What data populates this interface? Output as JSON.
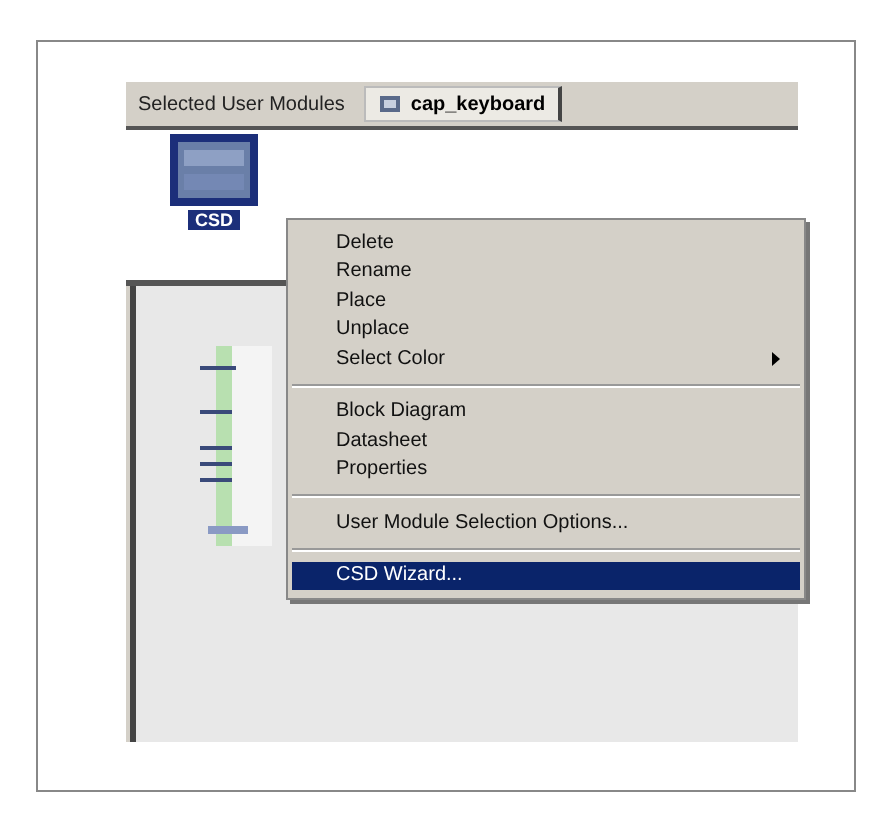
{
  "tab_bar": {
    "label": "Selected User Modules",
    "tabs": [
      {
        "label": "cap_keyboard",
        "selected": true
      }
    ]
  },
  "modules": [
    {
      "label": "CSD",
      "selected": true
    }
  ],
  "context_menu": {
    "items": [
      {
        "kind": "item",
        "label": "Delete",
        "submenu": false,
        "selected": false
      },
      {
        "kind": "item",
        "label": "Rename",
        "submenu": false,
        "selected": false
      },
      {
        "kind": "item",
        "label": "Place",
        "submenu": false,
        "selected": false
      },
      {
        "kind": "item",
        "label": "Unplace",
        "submenu": false,
        "selected": false
      },
      {
        "kind": "item",
        "label": "Select Color",
        "submenu": true,
        "selected": false
      },
      {
        "kind": "separator"
      },
      {
        "kind": "item",
        "label": "Block Diagram",
        "submenu": false,
        "selected": false
      },
      {
        "kind": "item",
        "label": "Datasheet",
        "submenu": false,
        "selected": false
      },
      {
        "kind": "item",
        "label": "Properties",
        "submenu": false,
        "selected": false
      },
      {
        "kind": "separator"
      },
      {
        "kind": "item",
        "label": "User Module Selection Options...",
        "submenu": false,
        "selected": false
      },
      {
        "kind": "separator"
      },
      {
        "kind": "item",
        "label": "CSD Wizard...",
        "submenu": false,
        "selected": true
      }
    ]
  }
}
